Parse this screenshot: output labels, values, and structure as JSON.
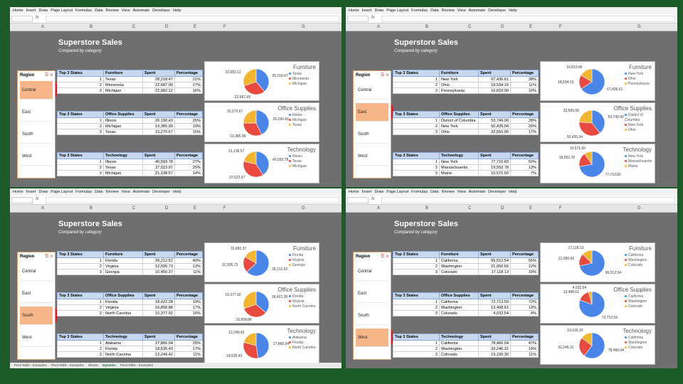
{
  "menu": [
    "Home",
    "Insert",
    "Draw",
    "Page Layout",
    "Formulas",
    "Data",
    "Review",
    "View",
    "Automate",
    "Developer",
    "Help"
  ],
  "formula": {
    "fx": "fx"
  },
  "columns": [
    "A",
    "B",
    "C",
    "D",
    "E",
    "F",
    "G"
  ],
  "report": {
    "title": "Superstore Sales",
    "subtitle": "Compared by category"
  },
  "slicer": {
    "header": "Region",
    "items": [
      "Central",
      "East",
      "South",
      "West"
    ]
  },
  "sheet_tabs": [
    "Pivot Table - Example1",
    "Pivot Table - Example2",
    "Sheet1",
    "Dynamic",
    "Pivot Table - Example3"
  ],
  "table_headers": {
    "top": "Top 3 States",
    "spent": "Spent",
    "pct": "Percentage"
  },
  "categories": [
    "Furniture",
    "Office Supplies",
    "Technology"
  ],
  "colors": {
    "c1": "#4a86e8",
    "c2": "#e84a3f",
    "c3": "#f2b632",
    "slicer_sel": "#f7b68a",
    "highlight": "#e0151d"
  },
  "panels": [
    {
      "selected": "Central",
      "groups": [
        {
          "category": "Furniture",
          "rows": [
            [
              "1",
              "Texas",
              "28,218.47",
              "21%"
            ],
            [
              "2",
              "Minnesota",
              "22,687.99",
              "17%"
            ],
            [
              "3",
              "Michigan",
              "22,082.12",
              "16%"
            ]
          ],
          "chart_data": {
            "type": "pie",
            "labels": [
              "Texas",
              "Minnesota",
              "Michigan"
            ],
            "values": [
              28218.47,
              22687.99,
              22082.12
            ],
            "title": "Furniture"
          }
        },
        {
          "category": "Office Supplies",
          "rows": [
            [
              "1",
              "Illinois",
              "26,190.43",
              "25%"
            ],
            [
              "2",
              "Michigan",
              "19,385.99",
              "19%"
            ],
            [
              "3",
              "Texas",
              "15,270.67",
              "15%"
            ]
          ],
          "chart_data": {
            "type": "pie",
            "labels": [
              "Illinois",
              "Michigan",
              "Texas"
            ],
            "values": [
              26190.43,
              19385.99,
              15270.67
            ],
            "title": "Office Supplies"
          }
        },
        {
          "category": "Technology",
          "rows": [
            [
              "1",
              "Illinois",
              "40,593.78",
              "27%"
            ],
            [
              "2",
              "Texas",
              "37,523.97",
              "25%"
            ],
            [
              "3",
              "Michigan",
              "21,138.57",
              "14%"
            ]
          ],
          "chart_data": {
            "type": "pie",
            "labels": [
              "Illinois",
              "Texas",
              "Michigan"
            ],
            "values": [
              40593.78,
              37523.97,
              21138.57
            ],
            "title": "Technology"
          }
        }
      ]
    },
    {
      "selected": "East",
      "groups": [
        {
          "category": "Furniture",
          "rows": [
            [
              "1",
              "New York",
              "67,436.61",
              "38%"
            ],
            [
              "2",
              "Ohio",
              "18,534.16",
              "11%"
            ],
            [
              "3",
              "Pennsylvania",
              "16,810.99",
              "10%"
            ]
          ],
          "chart_data": {
            "type": "pie",
            "labels": [
              "New York",
              "Ohio",
              "Pennsylvania"
            ],
            "values": [
              67436.61,
              18534.16,
              16810.99
            ],
            "title": "Furniture"
          }
        },
        {
          "category": "Office Supplies",
          "rows": [
            [
              "1",
              "District of Columbia",
              "53,749.90",
              "28%"
            ],
            [
              "2",
              "New York",
              "50,435.04",
              "26%"
            ],
            [
              "3",
              "Ohio",
              "32,555.06",
              "17%"
            ]
          ],
          "chart_data": {
            "type": "pie",
            "labels": [
              "District of Columbia",
              "New York",
              "Ohio"
            ],
            "values": [
              53749.9,
              50435.04,
              32555.06
            ],
            "title": "Office Supplies"
          }
        },
        {
          "category": "Technology",
          "rows": [
            [
              "1",
              "New York",
              "77,710.83",
              "50%"
            ],
            [
              "2",
              "Massachusetts",
              "19,552.78",
              "13%"
            ],
            [
              "3",
              "Maine",
              "10,571.60",
              "7%"
            ]
          ],
          "chart_data": {
            "type": "pie",
            "labels": [
              "New York",
              "Massachusetts",
              "Maine"
            ],
            "values": [
              77710.83,
              19552.78,
              10571.6
            ],
            "title": "Technology"
          }
        }
      ]
    },
    {
      "selected": "South",
      "groups": [
        {
          "category": "Furniture",
          "rows": [
            [
              "1",
              "Florida",
              "39,212.52",
              "40%"
            ],
            [
              "2",
              "Virginia",
              "12,505.73",
              "13%"
            ],
            [
              "3",
              "Georgia",
              "10,450.37",
              "11%"
            ]
          ],
          "chart_data": {
            "type": "pie",
            "labels": [
              "Florida",
              "Virginia",
              "Georgia"
            ],
            "values": [
              39212.52,
              12505.73,
              10450.37
            ],
            "title": "Furniture"
          }
        },
        {
          "category": "Office Supplies",
          "rows": [
            [
              "1",
              "Florida",
              "18,422.28",
              "19%"
            ],
            [
              "2",
              "Virginia",
              "16,858.88",
              "17%"
            ],
            [
              "3",
              "North Carolina",
              "15,377.92",
              "16%"
            ]
          ],
          "chart_data": {
            "type": "pie",
            "labels": [
              "Florida",
              "Virginia",
              "North Carolina"
            ],
            "values": [
              18422.28,
              16858.88,
              15377.92
            ],
            "title": "Office Supplies"
          }
        },
        {
          "category": "Technology",
          "rows": [
            [
              "1",
              "Alabama",
              "27,866.04",
              "25%"
            ],
            [
              "2",
              "Florida",
              "18,535.43",
              "17%"
            ],
            [
              "3",
              "North Carolina",
              "12,249.42",
              "11%"
            ]
          ],
          "chart_data": {
            "type": "pie",
            "labels": [
              "Alabama",
              "Florida",
              "North Carolina"
            ],
            "values": [
              27866.04,
              18535.43,
              12249.42
            ],
            "title": "Technology"
          }
        }
      ]
    },
    {
      "selected": "West",
      "groups": [
        {
          "category": "Furniture",
          "rows": [
            [
              "1",
              "California",
              "95,512.54",
              "55%"
            ],
            [
              "2",
              "Washington",
              "21,050.66",
              "12%"
            ],
            [
              "3",
              "Colorado",
              "17,118.13",
              "10%"
            ]
          ],
          "chart_data": {
            "type": "pie",
            "labels": [
              "California",
              "Washington",
              "Colorado"
            ],
            "values": [
              95512.54,
              21050.66,
              17118.13
            ],
            "title": "Furniture"
          }
        },
        {
          "category": "Office Supplies",
          "rows": [
            [
              "1",
              "California",
              "72,713.59",
              "72%"
            ],
            [
              "2",
              "Washington",
              "13,498.61",
              "13%"
            ],
            [
              "3",
              "Colorado",
              "4,032.54",
              "4%"
            ]
          ],
          "chart_data": {
            "type": "pie",
            "labels": [
              "California",
              "Washington",
              "Colorado"
            ],
            "values": [
              72713.59,
              13498.61,
              4032.54
            ],
            "title": "Office Supplies"
          }
        },
        {
          "category": "Technology",
          "rows": [
            [
              "1",
              "California",
              "78,466.04",
              "47%"
            ],
            [
              "2",
              "Washington",
              "32,246.31",
              "19%"
            ],
            [
              "3",
              "Colorado",
              "19,190.30",
              "11%"
            ]
          ],
          "chart_data": {
            "type": "pie",
            "labels": [
              "California",
              "Washington",
              "Colorado"
            ],
            "values": [
              78466.04,
              32246.31,
              19190.3
            ],
            "title": "Technology"
          }
        }
      ]
    }
  ]
}
